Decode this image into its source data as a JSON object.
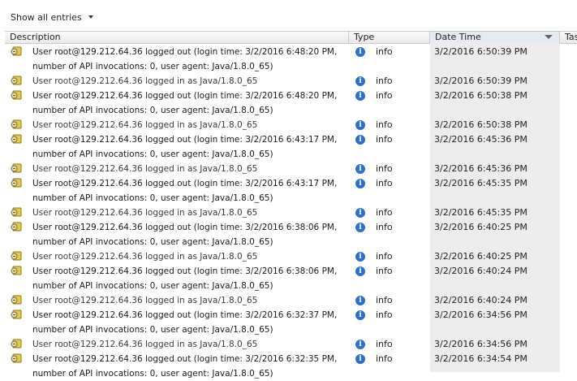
{
  "filter": {
    "label": "Show all entries"
  },
  "columns": {
    "description": "Description",
    "type": "Type",
    "datetime": "Date Time",
    "task": "Tas"
  },
  "rows": [
    {
      "desc": "User root@129.212.64.36 logged out (login time: 3/2/2016 6:48:20 PM,",
      "type": "info",
      "date": "3/2/2016 6:50:39 PM"
    },
    {
      "desc": "number of API invocations: 0, user agent: Java/1.8.0_65)",
      "type": "",
      "date": ""
    },
    {
      "desc": "User root@129.212.64.36 logged in as Java/1.8.0_65",
      "type": "info",
      "date": "3/2/2016 6:50:39 PM"
    },
    {
      "desc": "User root@129.212.64.36 logged out (login time: 3/2/2016 6:48:20 PM,",
      "type": "info",
      "date": "3/2/2016 6:50:38 PM"
    },
    {
      "desc": "number of API invocations: 0, user agent: Java/1.8.0_65)",
      "type": "",
      "date": ""
    },
    {
      "desc": "User root@129.212.64.36 logged in as Java/1.8.0_65",
      "type": "info",
      "date": "3/2/2016 6:50:38 PM"
    },
    {
      "desc": "User root@129.212.64.36 logged out (login time: 3/2/2016 6:43:17 PM,",
      "type": "info",
      "date": "3/2/2016 6:45:36 PM"
    },
    {
      "desc": "number of API invocations: 0, user agent: Java/1.8.0_65)",
      "type": "",
      "date": ""
    },
    {
      "desc": "User root@129.212.64.36 logged in as Java/1.8.0_65",
      "type": "info",
      "date": "3/2/2016 6:45:36 PM"
    },
    {
      "desc": "User root@129.212.64.36 logged out (login time: 3/2/2016 6:43:17 PM,",
      "type": "info",
      "date": "3/2/2016 6:45:35 PM"
    },
    {
      "desc": "number of API invocations: 0, user agent: Java/1.8.0_65)",
      "type": "",
      "date": ""
    },
    {
      "desc": "User root@129.212.64.36 logged in as Java/1.8.0_65",
      "type": "info",
      "date": "3/2/2016 6:45:35 PM"
    },
    {
      "desc": "User root@129.212.64.36 logged out (login time: 3/2/2016 6:38:06 PM,",
      "type": "info",
      "date": "3/2/2016 6:40:25 PM"
    },
    {
      "desc": "number of API invocations: 0, user agent: Java/1.8.0_65)",
      "type": "",
      "date": ""
    },
    {
      "desc": "User root@129.212.64.36 logged in as Java/1.8.0_65",
      "type": "info",
      "date": "3/2/2016 6:40:25 PM"
    },
    {
      "desc": "User root@129.212.64.36 logged out (login time: 3/2/2016 6:38:06 PM,",
      "type": "info",
      "date": "3/2/2016 6:40:24 PM"
    },
    {
      "desc": "number of API invocations: 0, user agent: Java/1.8.0_65)",
      "type": "",
      "date": ""
    },
    {
      "desc": "User root@129.212.64.36 logged in as Java/1.8.0_65",
      "type": "info",
      "date": "3/2/2016 6:40:24 PM"
    },
    {
      "desc": "User root@129.212.64.36 logged out (login time: 3/2/2016 6:32:37 PM,",
      "type": "info",
      "date": "3/2/2016 6:34:56 PM"
    },
    {
      "desc": "number of API invocations: 0, user agent: Java/1.8.0_65)",
      "type": "",
      "date": ""
    },
    {
      "desc": "User root@129.212.64.36 logged in as Java/1.8.0_65",
      "type": "info",
      "date": "3/2/2016 6:34:56 PM"
    },
    {
      "desc": "User root@129.212.64.36 logged out (login time: 3/2/2016 6:32:35 PM,",
      "type": "info",
      "date": "3/2/2016 6:34:54 PM"
    },
    {
      "desc": "number of API invocations: 0, user agent: Java/1.8.0_65)",
      "type": "",
      "date": ""
    }
  ],
  "row_meta": [
    {
      "icon": true,
      "style": "wrap"
    },
    {
      "icon": false,
      "style": "wrap"
    },
    {
      "icon": true,
      "style": "plain"
    },
    {
      "icon": true,
      "style": "wrap"
    },
    {
      "icon": false,
      "style": "wrap"
    },
    {
      "icon": true,
      "style": "plain"
    },
    {
      "icon": true,
      "style": "wrap"
    },
    {
      "icon": false,
      "style": "wrap"
    },
    {
      "icon": true,
      "style": "plain"
    },
    {
      "icon": true,
      "style": "wrap"
    },
    {
      "icon": false,
      "style": "wrap"
    },
    {
      "icon": true,
      "style": "plain"
    },
    {
      "icon": true,
      "style": "wrap"
    },
    {
      "icon": false,
      "style": "wrap"
    },
    {
      "icon": true,
      "style": "plain"
    },
    {
      "icon": true,
      "style": "wrap"
    },
    {
      "icon": false,
      "style": "wrap"
    },
    {
      "icon": true,
      "style": "plain"
    },
    {
      "icon": true,
      "style": "wrap"
    },
    {
      "icon": false,
      "style": "wrap"
    },
    {
      "icon": true,
      "style": "plain"
    },
    {
      "icon": true,
      "style": "wrap"
    },
    {
      "icon": false,
      "style": "wrap"
    }
  ],
  "icons": {
    "event": "event-log-icon",
    "info": "info-icon"
  }
}
